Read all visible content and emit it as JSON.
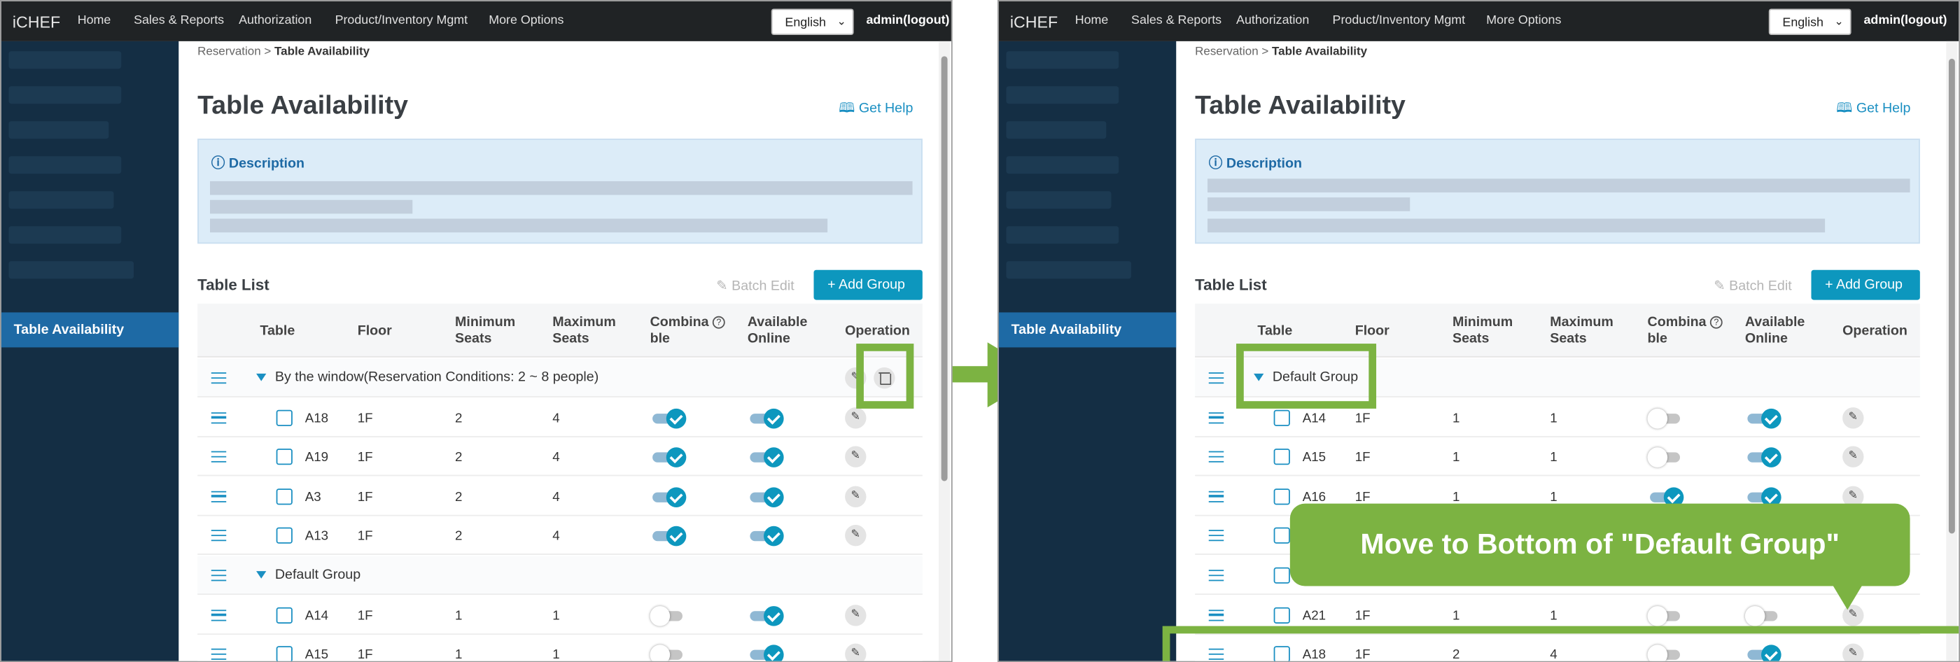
{
  "app": {
    "brand": "iCHEF",
    "nav": [
      "Home",
      "Sales & Reports",
      "Authorization",
      "Product/Inventory Mgmt",
      "More Options"
    ],
    "language": "English",
    "admin": "admin(logout)"
  },
  "breadcrumb": {
    "parent": "Reservation",
    "separator": ">",
    "current": "Table Availability"
  },
  "sidebar": {
    "active_item": "Table Availability"
  },
  "page": {
    "title": "Table Availability",
    "help_label": "Get Help",
    "help_icon": "book-icon",
    "description_title": "Description",
    "description_icon": "info-icon",
    "list_title": "Table List",
    "batch_edit_label": "Batch Edit",
    "add_group_label": "+ Add Group"
  },
  "table_headers": {
    "table": "Table",
    "floor": "Floor",
    "min_seats": [
      "Minimum",
      "Seats"
    ],
    "max_seats": [
      "Maximum",
      "Seats"
    ],
    "combinable": [
      "Combina",
      "ble"
    ],
    "available_online": [
      "Available",
      "Online"
    ],
    "operation": "Operation"
  },
  "left_rows": [
    {
      "type": "group",
      "label": "By the window(Reservation Conditions: 2 ~ 8 people)"
    },
    {
      "type": "table",
      "name": "A18",
      "floor": "1F",
      "min": "2",
      "max": "4",
      "combinable": true,
      "online": true
    },
    {
      "type": "table",
      "name": "A19",
      "floor": "1F",
      "min": "2",
      "max": "4",
      "combinable": true,
      "online": true
    },
    {
      "type": "table",
      "name": "A3",
      "floor": "1F",
      "min": "2",
      "max": "4",
      "combinable": true,
      "online": true
    },
    {
      "type": "table",
      "name": "A13",
      "floor": "1F",
      "min": "2",
      "max": "4",
      "combinable": true,
      "online": true
    },
    {
      "type": "group",
      "label": "Default Group"
    },
    {
      "type": "table",
      "name": "A14",
      "floor": "1F",
      "min": "1",
      "max": "1",
      "combinable": false,
      "online": true
    },
    {
      "type": "table",
      "name": "A15",
      "floor": "1F",
      "min": "1",
      "max": "1",
      "combinable": false,
      "online": true
    }
  ],
  "right_rows": [
    {
      "type": "group",
      "label": "Default Group"
    },
    {
      "type": "table",
      "name": "A14",
      "floor": "1F",
      "min": "1",
      "max": "1",
      "combinable": false,
      "online": true
    },
    {
      "type": "table",
      "name": "A15",
      "floor": "1F",
      "min": "1",
      "max": "1",
      "combinable": false,
      "online": true
    },
    {
      "type": "table",
      "name": "A16",
      "floor": "1F",
      "min": "1",
      "max": "1",
      "combinable": true,
      "online": true
    },
    {
      "type": "table",
      "name": "",
      "floor": "",
      "min": "",
      "max": "",
      "combinable": null,
      "online": null
    },
    {
      "type": "table",
      "name": "",
      "floor": "",
      "min": "",
      "max": "",
      "combinable": null,
      "online": null
    },
    {
      "type": "table",
      "name": "A21",
      "floor": "1F",
      "min": "1",
      "max": "1",
      "combinable": false,
      "online": false
    },
    {
      "type": "table",
      "name": "A18",
      "floor": "1F",
      "min": "2",
      "max": "4",
      "combinable": false,
      "online": true
    }
  ],
  "callout": "Move to Bottom of \"Default Group\"",
  "colors": {
    "accent": "#0d97be",
    "highlight": "#7cb342",
    "sidebar": "#142e44",
    "sidebar_active": "#1e6aa5"
  }
}
